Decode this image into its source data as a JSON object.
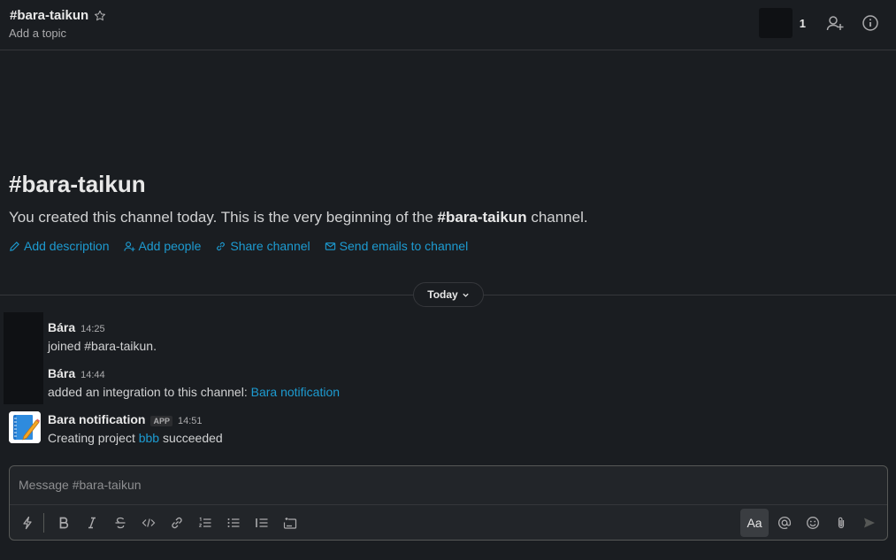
{
  "header": {
    "channel_name": "#bara-taikun",
    "topic": "Add a topic",
    "member_count": "1"
  },
  "intro": {
    "title": "#bara-taikun",
    "text_before": "You created this channel today. This is the very beginning of the ",
    "channel_bold": "#bara-taikun",
    "text_after": " channel.",
    "actions": {
      "add_description": "Add description",
      "add_people": "Add people",
      "share_channel": "Share channel",
      "send_emails": "Send emails to channel"
    }
  },
  "day_divider": "Today",
  "messages": [
    {
      "author": "Bára",
      "time": "14:25",
      "text": "joined #bara-taikun."
    },
    {
      "author": "Bára",
      "time": "14:44",
      "text": "added an integration to this channel: ",
      "link": "Bara notification"
    },
    {
      "author": "Bara notification",
      "badge": "APP",
      "time": "14:51",
      "text_before": "Creating project ",
      "link": "bbb",
      "text_after": " succeeded"
    }
  ],
  "composer": {
    "placeholder": "Message #bara-taikun",
    "format_label": "Aa"
  },
  "colors": {
    "background": "#1a1d21",
    "link": "#1d9bd1",
    "text": "#d1d2d3"
  }
}
